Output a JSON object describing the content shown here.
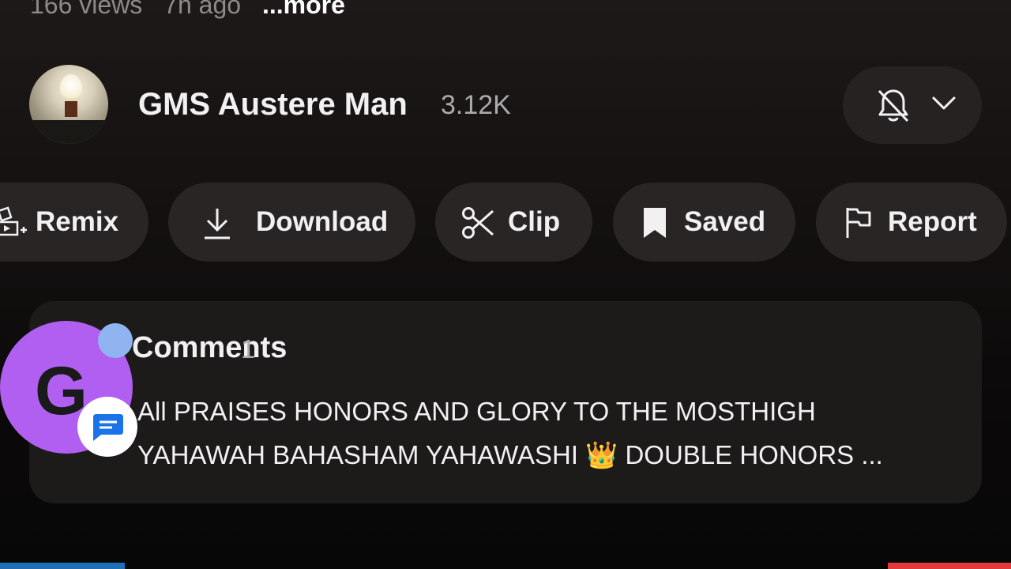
{
  "video": {
    "views": "166 views",
    "age": "7h ago",
    "more_label": "...more"
  },
  "channel": {
    "name": "GMS Austere Man",
    "subscribers": "3.12K"
  },
  "actions": {
    "remix": "Remix",
    "download": "Download",
    "clip": "Clip",
    "saved": "Saved",
    "report": "Report"
  },
  "comments": {
    "title": "Comments",
    "count": "1",
    "top_comment_line1": "All PRAISES HONORS AND GLORY TO THE MOSTHIGH",
    "top_comment_line2": "YAHAWAH BAHASHAM YAHAWASHI 👑 DOUBLE HONORS ..."
  },
  "overlay": {
    "bubble_letter": "G"
  },
  "colors": {
    "chip_bg": "#2a2525",
    "card_bg": "#1d1a1a",
    "bubble_purple": "#b15ff0",
    "messages_blue": "#1a73e8"
  }
}
